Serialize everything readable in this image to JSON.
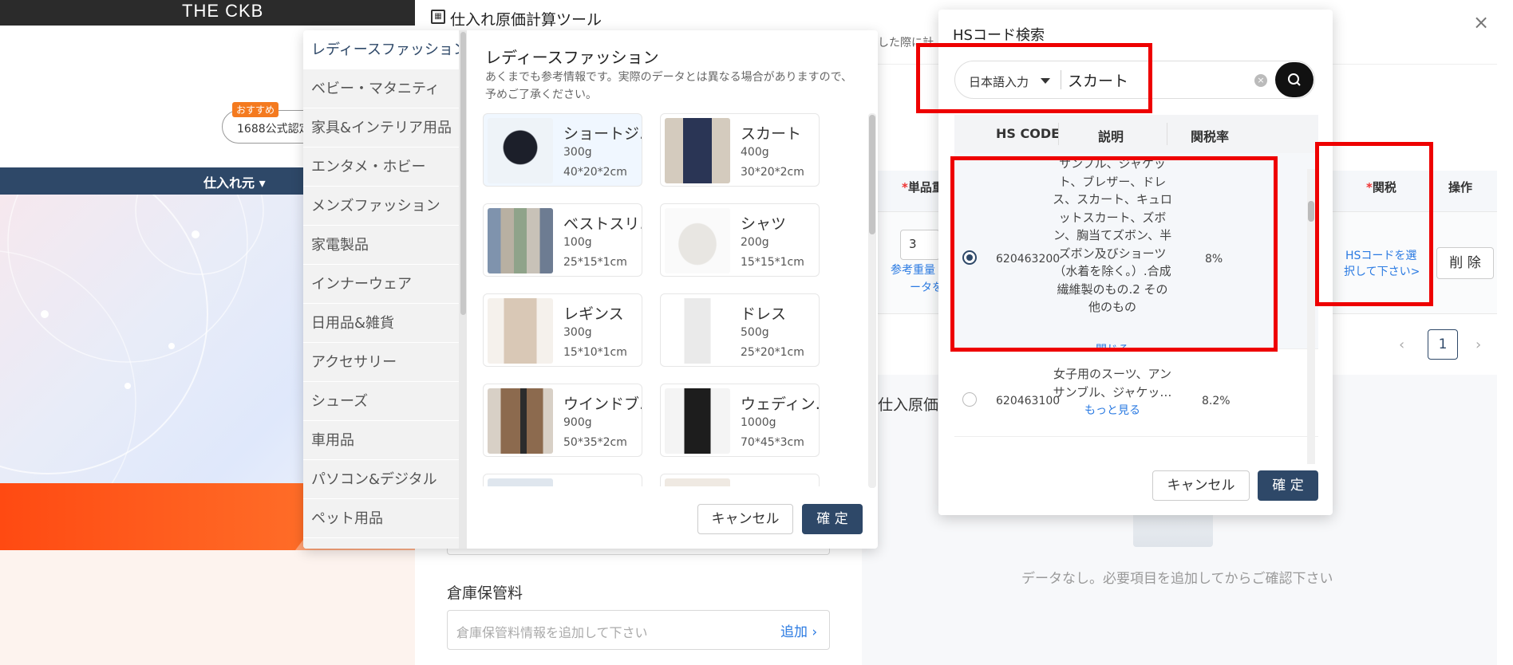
{
  "background": {
    "logo": "THE CKB",
    "recommend_badge": "おすすめ",
    "pill_text": "1688公式認定",
    "nav_item": "仕入れ元 ▾"
  },
  "tool": {
    "title": "仕入れ原価計算ツール",
    "title_icon": "calculator-icon",
    "close": "×",
    "notice": "した際に計",
    "table": {
      "col_weight": "単品重",
      "col_duty": "関税",
      "col_action": "操作",
      "required_mark": "*",
      "weight_value": "3",
      "ref_link_line1": "参考重量",
      "ref_link_line2": "ータを",
      "hs_select_line1": "HSコードを選",
      "hs_select_line2": "択して下さい>",
      "delete_label": "削 除"
    },
    "pager": {
      "prev": "‹",
      "page": "1",
      "next": "›"
    },
    "cost_label": "仕入原価",
    "empty_text": "データなし。必要項目を追加してからご確認下さい",
    "warehouse": {
      "label": "倉庫保管料",
      "placeholder": "倉庫保管料情報を追加して下さい",
      "add_label": "追加 ›"
    }
  },
  "category_popup": {
    "categories": [
      "レディースファッション",
      "ベビー・マタニティ",
      "家具&インテリア用品",
      "エンタメ・ホビー",
      "メンズファッション",
      "家電製品",
      "インナーウェア",
      "日用品&雑貨",
      "アクセサリー",
      "シューズ",
      "車用品",
      "パソコン&デジタル",
      "ペット用品"
    ],
    "active_index": 0,
    "title": "レディースファッション",
    "note": "あくまでも参考情報です。実際のデータとは異なる場合がありますので、予めご了承ください。",
    "products": [
      {
        "name": "ショートジ…",
        "weight": "300g",
        "dims": "40*20*2cm",
        "color": "#1c1f2a"
      },
      {
        "name": "スカート",
        "weight": "400g",
        "dims": "30*20*2cm",
        "color": "#2a3555"
      },
      {
        "name": "ベストスリ…",
        "weight": "100g",
        "dims": "25*15*1cm",
        "color": "#8a9bb0"
      },
      {
        "name": "シャツ",
        "weight": "200g",
        "dims": "15*15*1cm",
        "color": "#e8e6e2"
      },
      {
        "name": "レギンス",
        "weight": "300g",
        "dims": "15*10*1cm",
        "color": "#d9c8b6"
      },
      {
        "name": "ドレス",
        "weight": "500g",
        "dims": "25*20*1cm",
        "color": "#efefef"
      },
      {
        "name": "ウインドブ…",
        "weight": "900g",
        "dims": "50*35*2cm",
        "color": "#8c6a4e"
      },
      {
        "name": "ウェディン…",
        "weight": "1000g",
        "dims": "70*45*3cm",
        "color": "#1d1d1d"
      }
    ],
    "cancel_label": "キャンセル",
    "ok_label": "確 定"
  },
  "hs_popup": {
    "title": "HSコード検索",
    "language": "日本語入力",
    "query": "スカート",
    "clear": "×",
    "columns": {
      "code": "HS CODE",
      "desc": "説明",
      "rate": "関税率"
    },
    "rows": [
      {
        "code": "620463200",
        "description": "サンプル、ジャケット、ブレザー、ドレス、スカート、キュロットスカート、ズボン、胸当てズボン、半ズボン及びショーツ（水着を除く。）.合成繊維製のもの.2 その他のもの",
        "link": "閉じる",
        "rate": "8%",
        "selected": true
      },
      {
        "code": "620463100",
        "description": "女子用のスーツ、アンサンブル、ジャケッ…",
        "link": "もっと見る",
        "rate": "8.2%",
        "selected": false
      }
    ],
    "cancel_label": "キャンセル",
    "ok_label": "確 定"
  }
}
